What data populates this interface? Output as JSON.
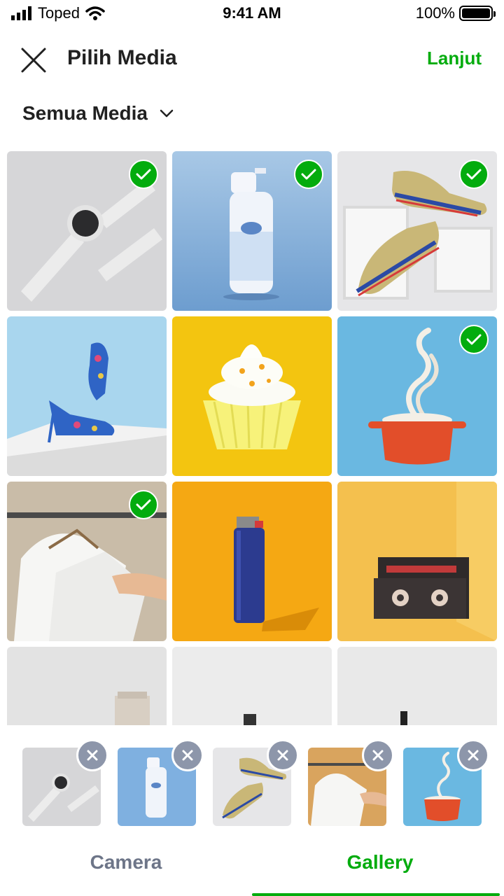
{
  "status_bar": {
    "carrier": "Toped",
    "time": "9:41 AM",
    "battery": "100%"
  },
  "header": {
    "title": "Pilih Media",
    "next_label": "Lanjut"
  },
  "filter": {
    "label": "Semua Media"
  },
  "grid": {
    "items": [
      {
        "subject": "smartwatch",
        "selected": true
      },
      {
        "subject": "air freshener spray",
        "selected": true
      },
      {
        "subject": "sneakers",
        "selected": true
      },
      {
        "subject": "floral high heels",
        "selected": false
      },
      {
        "subject": "cupcake",
        "selected": false
      },
      {
        "subject": "noodle pot",
        "selected": true
      },
      {
        "subject": "shirts on rack",
        "selected": true
      },
      {
        "subject": "lighter",
        "selected": false
      },
      {
        "subject": "cassette tape",
        "selected": false
      },
      {
        "subject": "cosmetic tube",
        "selected": false
      },
      {
        "subject": "bottle",
        "selected": false
      },
      {
        "subject": "bottle",
        "selected": false
      }
    ]
  },
  "tray": {
    "selected": [
      "smartwatch",
      "air freshener spray",
      "sneakers",
      "shirts on rack",
      "noodle pot"
    ]
  },
  "tabs": {
    "camera": "Camera",
    "gallery": "Gallery",
    "active": "gallery"
  },
  "colors": {
    "accent": "#03ac0e",
    "remove_badge": "#8d96aa",
    "inactive_tab": "#6d7588"
  },
  "icons": {
    "close": "close-icon",
    "dropdown": "chevron-down-icon",
    "check": "check-icon",
    "remove": "remove-icon"
  }
}
